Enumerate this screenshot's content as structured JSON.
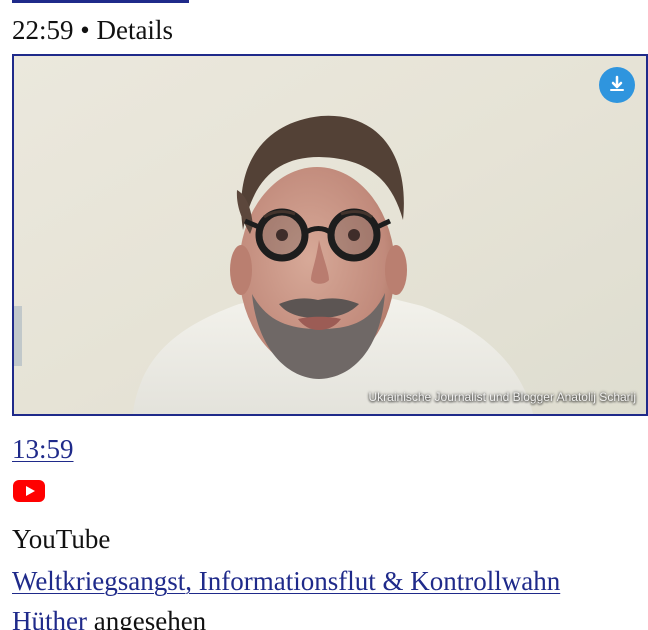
{
  "activity": {
    "time": "22:59",
    "separator": "•",
    "details_label": "Details"
  },
  "video": {
    "duration": "13:59",
    "caption": "Ukrainische Journalist und Blogger Anatolij Scharij",
    "download_badge_icon": "download-icon"
  },
  "source": {
    "name": "YouTube",
    "icon": "youtube-icon",
    "icon_color": "#FF0000"
  },
  "item": {
    "title": "Weltkriegsangst, Informationsflut & Kontrollwahn",
    "person": "Hüther",
    "viewed_text": " angesehen"
  },
  "colors": {
    "link": "#1F2A8A",
    "text": "#111111",
    "background": "#FFFFFF"
  }
}
